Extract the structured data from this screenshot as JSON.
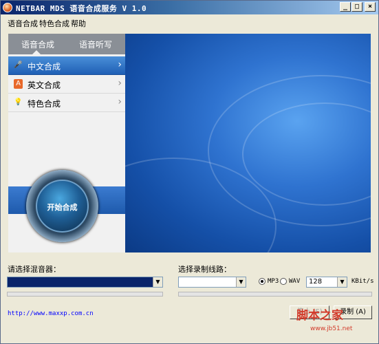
{
  "window": {
    "title": "NETBAR MDS 语音合成服务 V 1.0",
    "controls": [
      "_",
      "□",
      "×"
    ]
  },
  "menu": [
    "语音合成",
    "特色合成",
    "帮助"
  ],
  "sidebar": {
    "tabs": [
      "语音合成",
      "语音听写"
    ],
    "items": [
      {
        "label": "中文合成",
        "icon": "microphone-icon"
      },
      {
        "label": "英文合成",
        "icon": "letter-a-icon"
      },
      {
        "label": "特色合成",
        "icon": "lightbulb-icon"
      }
    ],
    "start_label": "开始合成"
  },
  "mixer": {
    "label": "请选择混音器：",
    "value": ""
  },
  "line": {
    "label": "选择录制线路：",
    "value": ""
  },
  "format": {
    "mp3": "MP3",
    "wav": "WAV",
    "selected": "MP3"
  },
  "bitrate": {
    "value": "128",
    "unit": "KBit/s"
  },
  "footer": {
    "url": "http://www.maxxp.com.cn",
    "stop_label": "停止 (S)",
    "record_label": "录制 (A)"
  },
  "watermark": {
    "text": "脚本之家",
    "sub": "www.jb51.net"
  },
  "colors": {
    "accent": "#1f5fb5",
    "banner": "#2f73d0",
    "watermark": "#d23a2a"
  }
}
